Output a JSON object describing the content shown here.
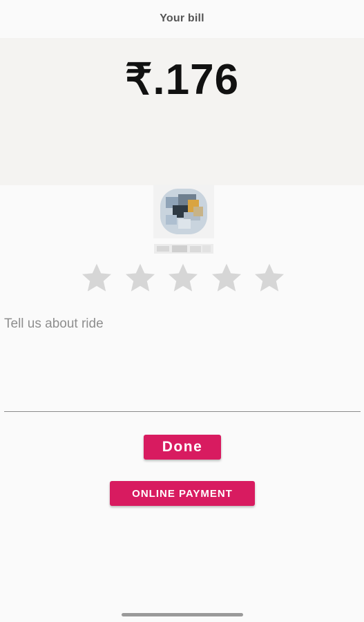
{
  "header": {
    "title": "Your bill"
  },
  "bill": {
    "amount": "₹.176"
  },
  "driver": {
    "avatar_icon": "blurred-profile-photo",
    "name_icon": "blurred-driver-name"
  },
  "rating": {
    "max": 5,
    "selected": 0,
    "star_icon": "star-icon",
    "empty_color": "#d6d6d6"
  },
  "feedback": {
    "placeholder": "Tell us about ride",
    "value": ""
  },
  "actions": {
    "done_label": "Done",
    "online_payment_label": "ONLINE PAYMENT",
    "accent_color": "#d81b60"
  }
}
